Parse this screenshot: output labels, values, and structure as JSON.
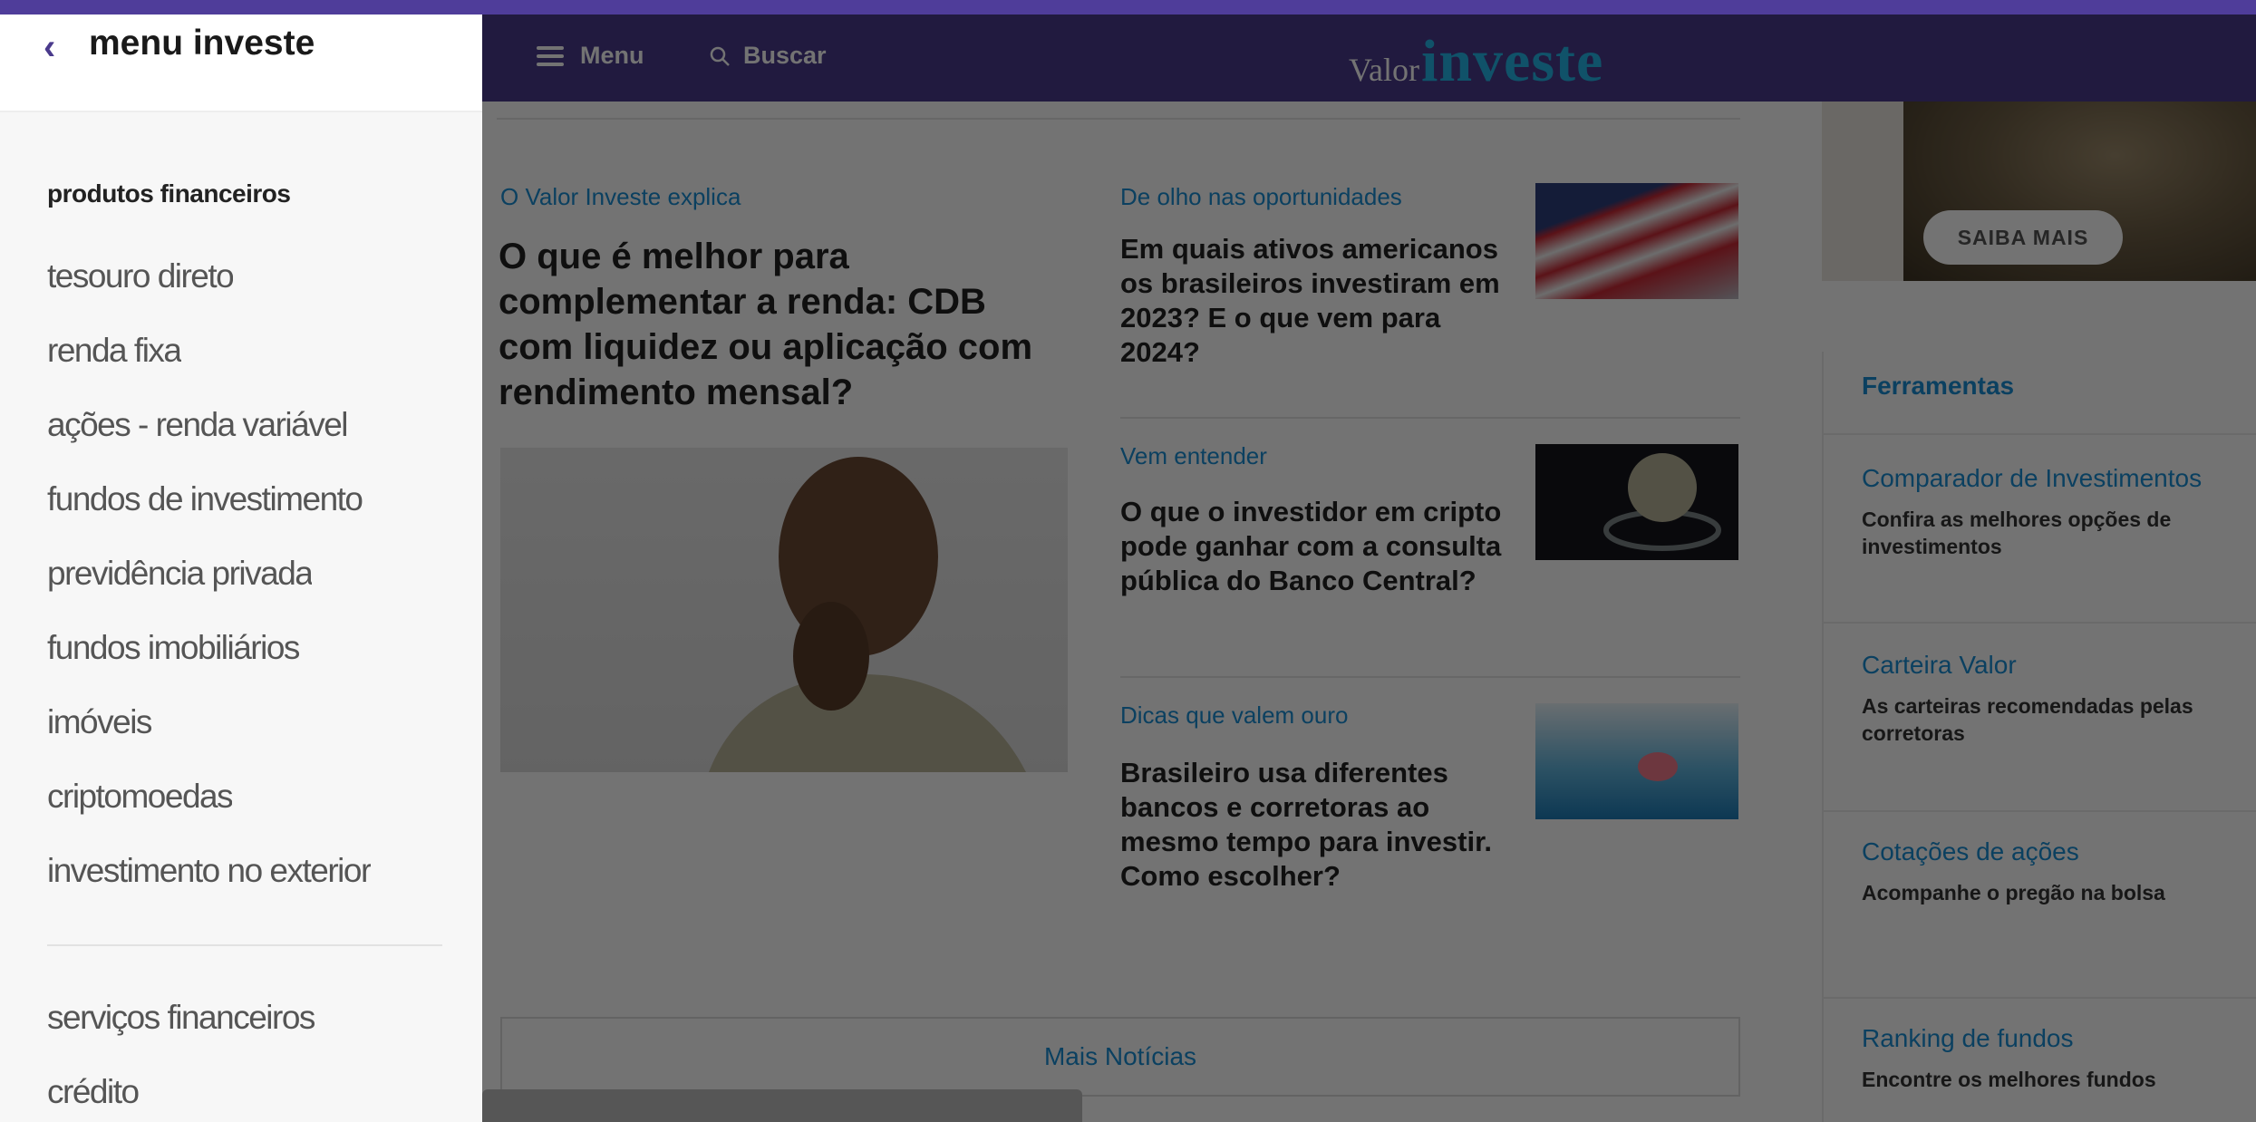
{
  "header": {
    "menu_label": "Menu",
    "search_label": "Buscar",
    "logo_part1": "Valor",
    "logo_part2": "investe"
  },
  "articles": {
    "main": {
      "eyebrow": "O Valor Investe explica",
      "title": "O que é melhor para complementar a renda: CDB com liquidez ou aplicação com rendimento mensal?"
    },
    "side": [
      {
        "eyebrow": "De olho nas oportunidades",
        "title": "Em quais ativos americanos os brasileiros investiram em 2023? E o que vem para 2024?"
      },
      {
        "eyebrow": "Vem entender",
        "title": "O que o investidor em cripto pode ganhar com a consulta pública do Banco Central?"
      },
      {
        "eyebrow": "Dicas que valem ouro",
        "title": "Brasileiro usa diferentes bancos e corretoras ao mesmo tempo para investir. Como escolher?"
      }
    ],
    "more_label": "Mais Notícias"
  },
  "ad": {
    "button_label": "SAIBA MAIS"
  },
  "tools": {
    "title": "Ferramentas",
    "items": [
      {
        "name": "Comparador de Investimentos",
        "desc": "Confira as melhores opções de investimentos"
      },
      {
        "name": "Carteira Valor",
        "desc": "As carteiras recomendadas pelas corretoras"
      },
      {
        "name": "Cotações de ações",
        "desc": "Acompanhe o pregão na bolsa"
      },
      {
        "name": "Ranking de fundos",
        "desc": "Encontre os melhores fundos"
      }
    ]
  },
  "side_menu": {
    "back_icon": "‹",
    "title": "menu investe",
    "section": "produtos financeiros",
    "items": [
      "tesouro direto",
      "renda fixa",
      "ações - renda variável",
      "fundos de investimento",
      "previdência privada",
      "fundos imobiliários",
      "imóveis",
      "criptomoedas",
      "investimento no exterior"
    ],
    "items2": [
      "serviços financeiros",
      "crédito"
    ]
  }
}
